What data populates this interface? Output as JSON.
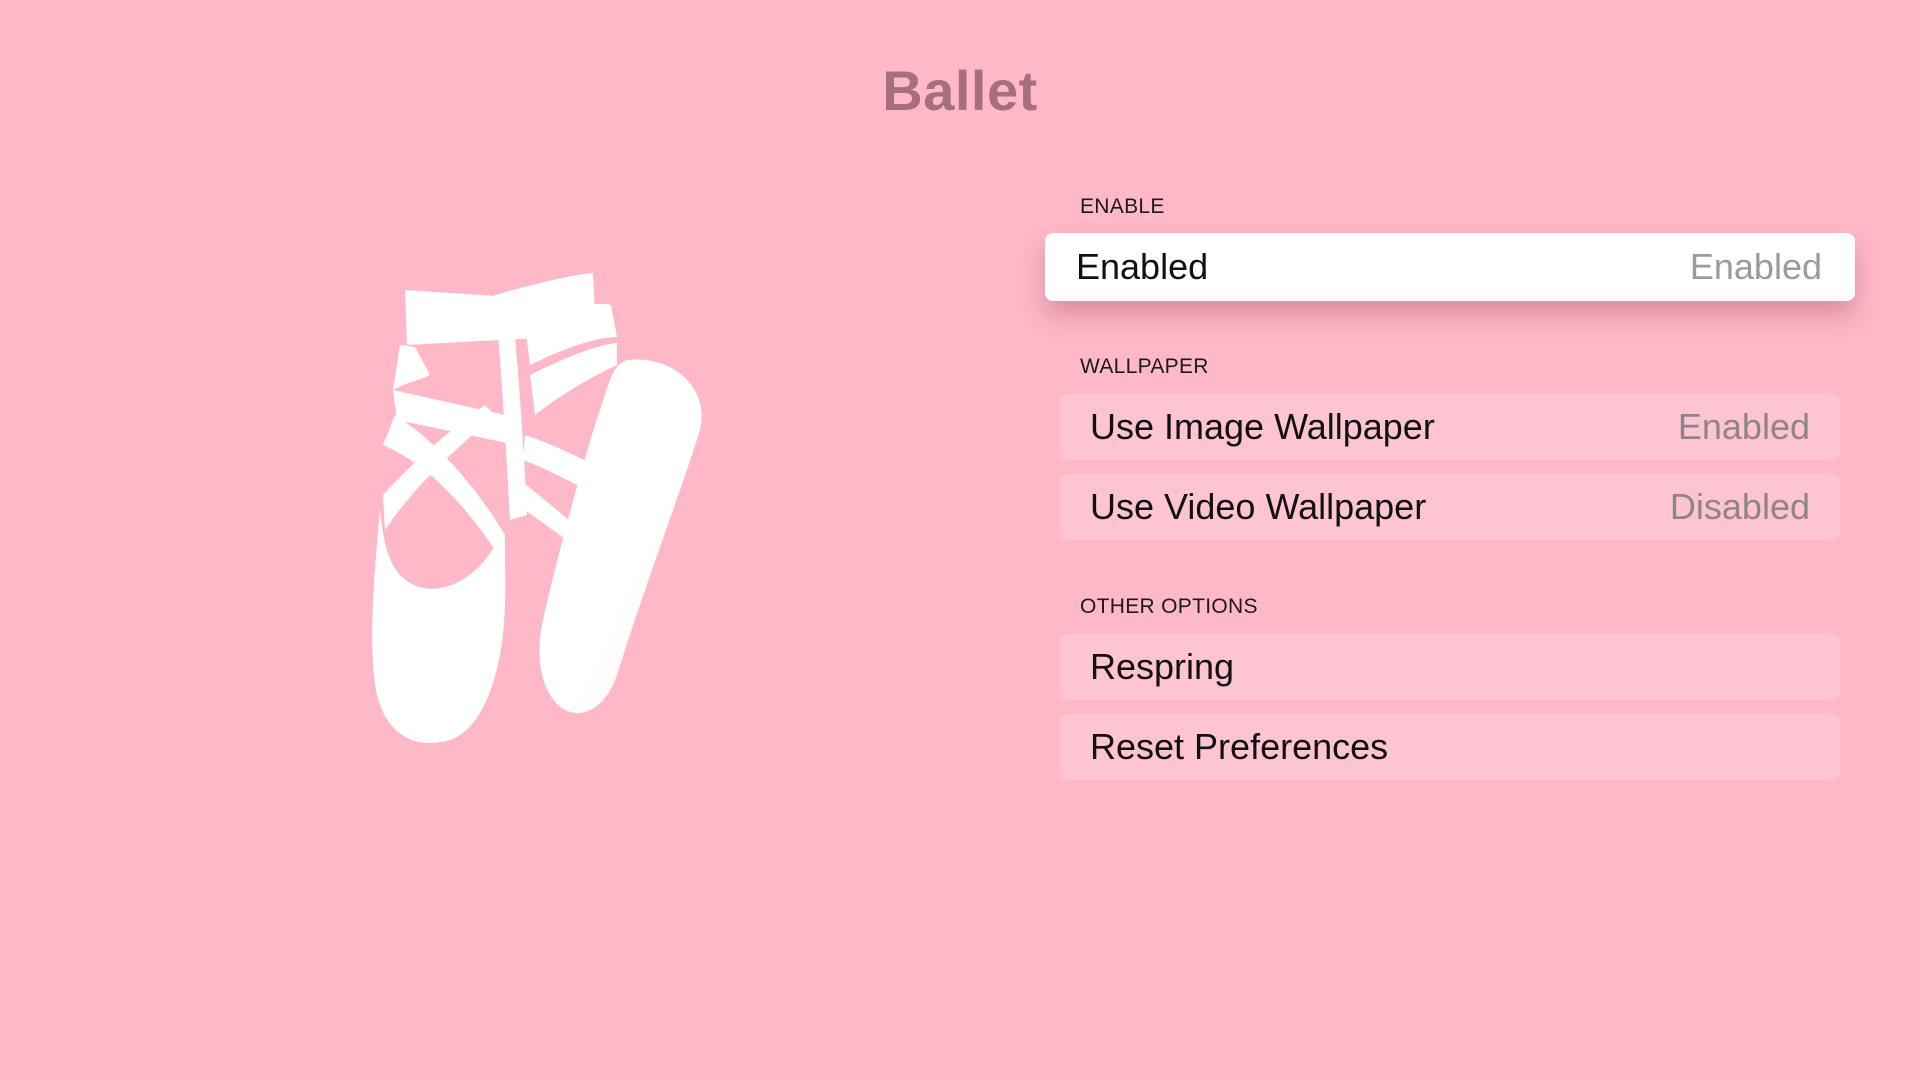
{
  "title": "Ballet",
  "illustration": {
    "icon": "ballet-shoes-icon",
    "color": "#ffffff"
  },
  "colors": {
    "background": "#ffb8c8",
    "title": "#a66f7d",
    "focused_row": "#ffffff"
  },
  "sections": [
    {
      "header": "ENABLE",
      "rows": [
        {
          "label": "Enabled",
          "value": "Enabled",
          "focused": true
        }
      ]
    },
    {
      "header": "WALLPAPER",
      "rows": [
        {
          "label": "Use Image Wallpaper",
          "value": "Enabled"
        },
        {
          "label": "Use Video Wallpaper",
          "value": "Disabled"
        }
      ]
    },
    {
      "header": "OTHER OPTIONS",
      "rows": [
        {
          "label": "Respring",
          "value": ""
        },
        {
          "label": "Reset Preferences",
          "value": ""
        }
      ]
    }
  ]
}
